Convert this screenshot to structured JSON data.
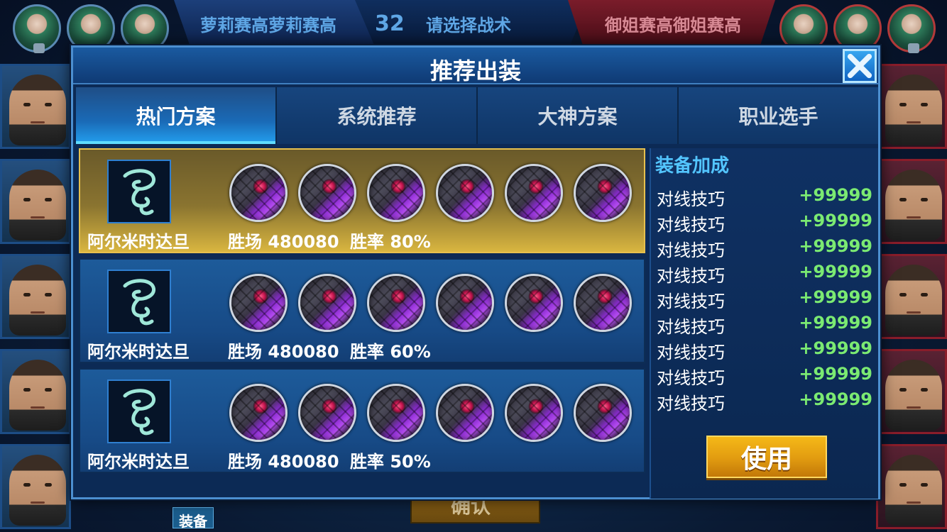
{
  "topbar": {
    "left_team": "萝莉赛高萝莉赛高",
    "timer": "32",
    "prompt": "请选择战术",
    "right_team": "御姐赛高御姐赛高"
  },
  "background": {
    "confirm_label": "确认",
    "equip_label": "装备"
  },
  "modal": {
    "title": "推荐出装",
    "tabs": [
      "热门方案",
      "系统推荐",
      "大神方案",
      "职业选手"
    ],
    "active_tab": 0,
    "plans": [
      {
        "hero": "阿尔米时达旦",
        "wins": "胜场 480080",
        "rate": "胜率 80%",
        "selected": true
      },
      {
        "hero": "阿尔米时达旦",
        "wins": "胜场 480080",
        "rate": "胜率 60%",
        "selected": false
      },
      {
        "hero": "阿尔米时达旦",
        "wins": "胜场 480080",
        "rate": "胜率 50%",
        "selected": false
      }
    ],
    "bonus": {
      "title": "装备加成",
      "rows": [
        {
          "label": "对线技巧",
          "value": "+99999"
        },
        {
          "label": "对线技巧",
          "value": "+99999"
        },
        {
          "label": "对线技巧",
          "value": "+99999"
        },
        {
          "label": "对线技巧",
          "value": "+99999"
        },
        {
          "label": "对线技巧",
          "value": "+99999"
        },
        {
          "label": "对线技巧",
          "value": "+99999"
        },
        {
          "label": "对线技巧",
          "value": "+99999"
        },
        {
          "label": "对线技巧",
          "value": "+99999"
        },
        {
          "label": "对线技巧",
          "value": "+99999"
        }
      ]
    },
    "use_label": "使用"
  },
  "colors": {
    "accent_blue": "#4c8fd0",
    "selected_gold": "#e6c04e",
    "bonus_green": "#7bea72",
    "title_cyan": "#53c5ff"
  }
}
